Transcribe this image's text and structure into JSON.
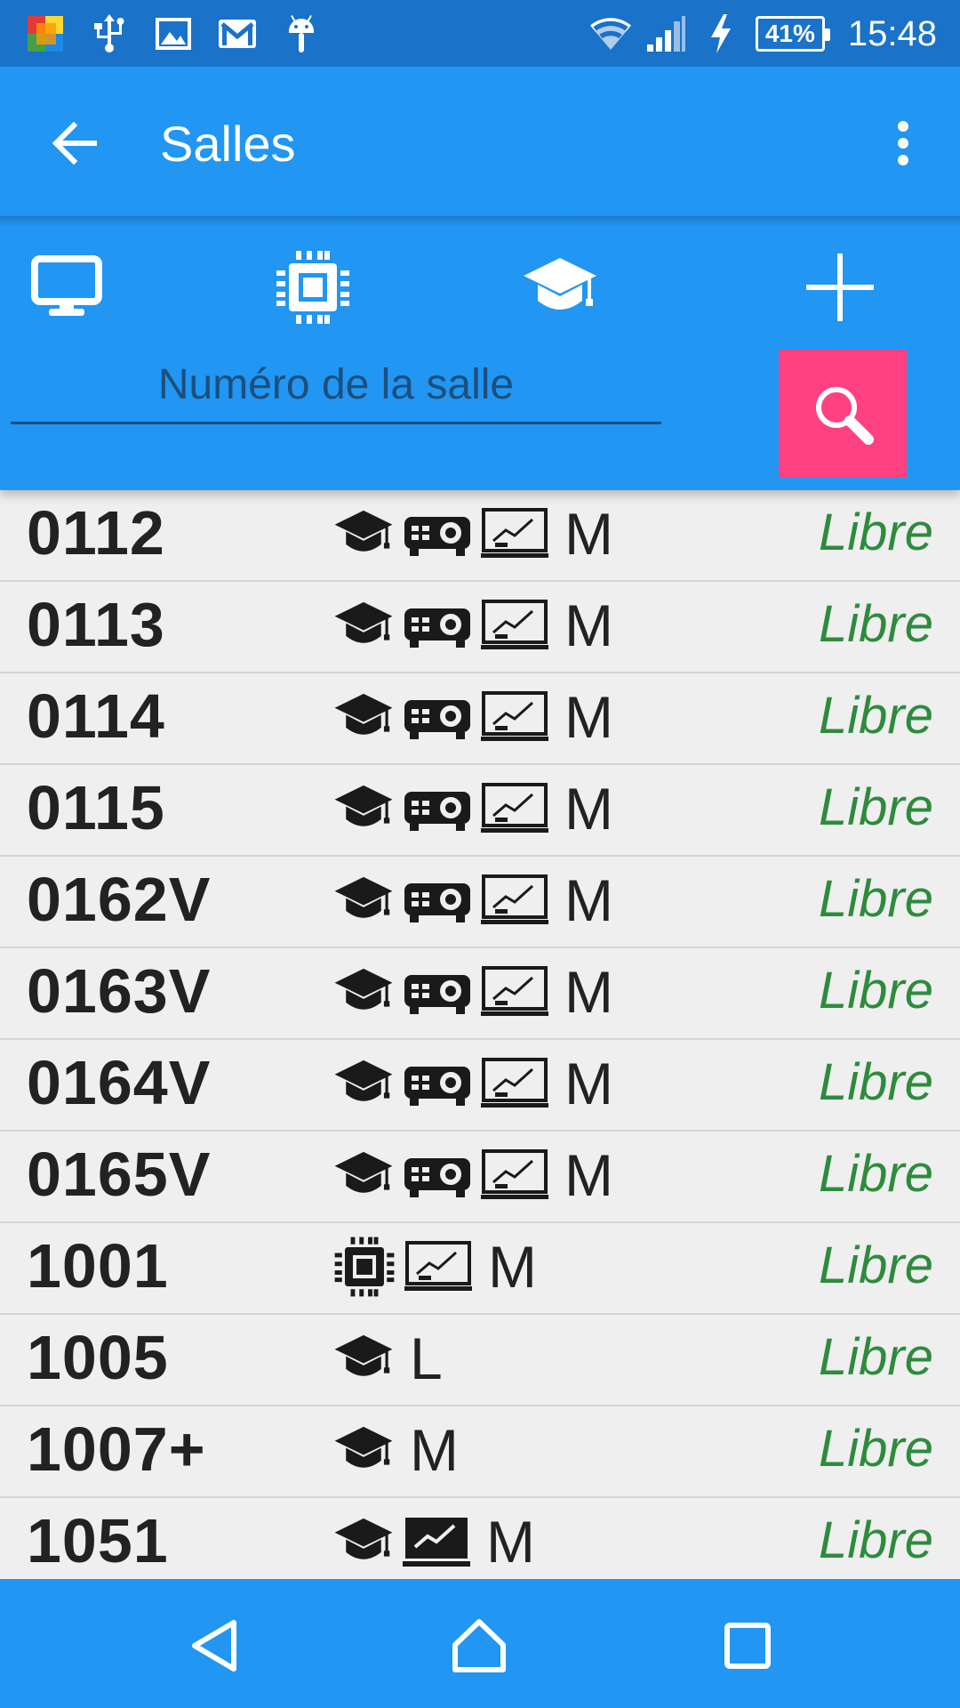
{
  "status_bar": {
    "battery": "41%",
    "time": "15:48",
    "left_icons": [
      "app-icon",
      "usb-icon",
      "image-icon",
      "gmail-icon",
      "android-debug-icon"
    ],
    "right_icons": [
      "wifi-icon",
      "cell-signal-icon",
      "charging-icon",
      "battery-icon"
    ]
  },
  "app_bar": {
    "title": "Salles"
  },
  "filters": {
    "icons": [
      "monitor-icon",
      "chip-icon",
      "graduation-cap-icon",
      "plus-icon"
    ]
  },
  "search": {
    "placeholder": "Numéro de la salle"
  },
  "colors": {
    "primary": "#2196f3",
    "status_bar": "#1a72c9",
    "accent": "#ff4081",
    "status_free": "#2e8b3d"
  },
  "rooms": [
    {
      "number": "0112",
      "equipment": [
        "graduation-cap-icon",
        "projector-icon",
        "whiteboard-icon"
      ],
      "size": "M",
      "status": "Libre"
    },
    {
      "number": "0113",
      "equipment": [
        "graduation-cap-icon",
        "projector-icon",
        "whiteboard-icon"
      ],
      "size": "M",
      "status": "Libre"
    },
    {
      "number": "0114",
      "equipment": [
        "graduation-cap-icon",
        "projector-icon",
        "whiteboard-icon"
      ],
      "size": "M",
      "status": "Libre"
    },
    {
      "number": "0115",
      "equipment": [
        "graduation-cap-icon",
        "projector-icon",
        "whiteboard-icon"
      ],
      "size": "M",
      "status": "Libre"
    },
    {
      "number": "0162V",
      "equipment": [
        "graduation-cap-icon",
        "projector-icon",
        "whiteboard-icon"
      ],
      "size": "M",
      "status": "Libre"
    },
    {
      "number": "0163V",
      "equipment": [
        "graduation-cap-icon",
        "projector-icon",
        "whiteboard-icon"
      ],
      "size": "M",
      "status": "Libre"
    },
    {
      "number": "0164V",
      "equipment": [
        "graduation-cap-icon",
        "projector-icon",
        "whiteboard-icon"
      ],
      "size": "M",
      "status": "Libre"
    },
    {
      "number": "0165V",
      "equipment": [
        "graduation-cap-icon",
        "projector-icon",
        "whiteboard-icon"
      ],
      "size": "M",
      "status": "Libre"
    },
    {
      "number": "1001",
      "equipment": [
        "chip-icon",
        "whiteboard-icon"
      ],
      "size": "M",
      "status": "Libre"
    },
    {
      "number": "1005",
      "equipment": [
        "graduation-cap-icon"
      ],
      "size": "L",
      "status": "Libre"
    },
    {
      "number": "1007+",
      "equipment": [
        "graduation-cap-icon"
      ],
      "size": "M",
      "status": "Libre"
    },
    {
      "number": "1051",
      "equipment": [
        "graduation-cap-icon",
        "screen-filled-icon"
      ],
      "size": "M",
      "status": "Libre"
    }
  ]
}
